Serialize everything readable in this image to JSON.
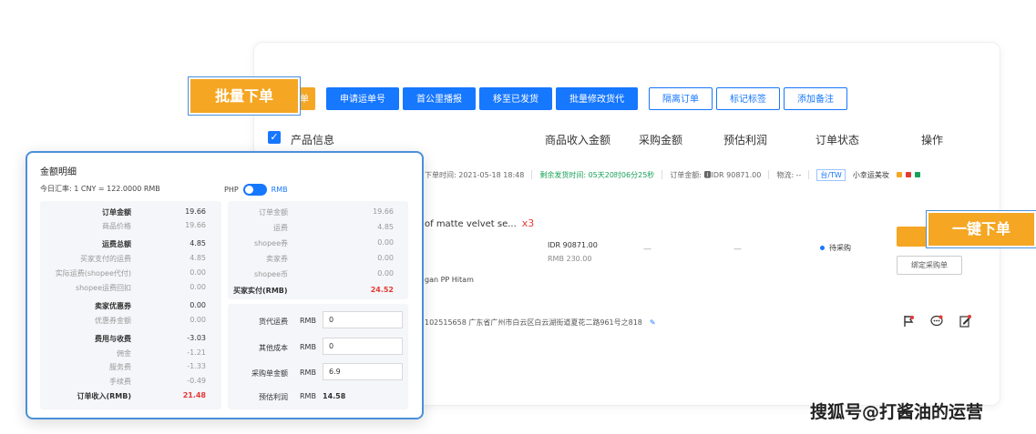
{
  "toolbar": {
    "first_tail": "单",
    "buttons": [
      "申请运单号",
      "首公里播报",
      "移至已发货",
      "批量修改货代"
    ],
    "outline_buttons": [
      "隔离订单",
      "标记标签",
      "添加备注"
    ]
  },
  "table_header": {
    "product": "产品信息",
    "income": "商品收入金额",
    "purchase": "采购金额",
    "profit": "预估利润",
    "status": "订单状态",
    "action": "操作"
  },
  "order": {
    "order_time": "下单时间: 2021-05-18 18:48",
    "remaining": "剩余发货时间: 05天20时06分25秒",
    "amount": "订单金额: 🅸IDR 90871.00",
    "logistics": "物流: --",
    "shop_tag": "台/TW",
    "shop_name": "小幸运美妆",
    "product_name": "of matte velvet se...",
    "quantity": "x3",
    "variant": "gan PP Hitam",
    "price_idr": "IDR 90871.00",
    "price_rmb": "RMB 230.00",
    "purchase_dash": "—",
    "profit_dash": "—",
    "status": "待采购",
    "bind_button": "绑定采购单",
    "address": "102515658  广东省广州市白云区白云湖街道夏花二路961号之818",
    "edit_icon": "✎"
  },
  "callouts": {
    "batch": "批量下单",
    "one_click": "一键下单"
  },
  "popup": {
    "title": "金额明细",
    "rate": "今日汇率: 1 CNY = 122.0000 RMB",
    "toggle_left": "PHP",
    "toggle_right": "RMB",
    "left_rows": [
      {
        "label": "订单金额",
        "value": "19.66",
        "bold": true
      },
      {
        "label": "商品价格",
        "value": "19.66",
        "bold": false
      },
      {
        "label": "运费总额",
        "value": "4.85",
        "bold": true
      },
      {
        "label": "买家支付的运费",
        "value": "4.85",
        "bold": false
      },
      {
        "label": "实际运费(shopee代付)",
        "value": "0.00",
        "bold": false
      },
      {
        "label": "shopee运费回扣",
        "value": "0.00",
        "bold": false
      },
      {
        "label": "卖家优惠券",
        "value": "0.00",
        "bold": true
      },
      {
        "label": "优惠券金额",
        "value": "0.00",
        "bold": false
      },
      {
        "label": "费用与收费",
        "value": "-3.03",
        "bold": true
      },
      {
        "label": "佣金",
        "value": "-1.21",
        "bold": false
      },
      {
        "label": "服务费",
        "value": "-1.33",
        "bold": false
      },
      {
        "label": "手续费",
        "value": "-0.49",
        "bold": false
      },
      {
        "label": "订单收入(RMB)",
        "value": "21.48",
        "bold": true,
        "red": true
      }
    ],
    "right_rows": [
      {
        "label": "订单金额",
        "value": "19.66"
      },
      {
        "label": "运费",
        "value": "4.85"
      },
      {
        "label": "shopee券",
        "value": "0.00"
      },
      {
        "label": "卖家券",
        "value": "0.00"
      },
      {
        "label": "shopee币",
        "value": "0.00"
      },
      {
        "label": "买家实付(RMB)",
        "value": "24.52",
        "red": true
      }
    ],
    "inputs": [
      {
        "label": "货代运费",
        "currency": "RMB",
        "value": "0"
      },
      {
        "label": "其他成本",
        "currency": "RMB",
        "value": "0"
      },
      {
        "label": "采购单金额",
        "currency": "RMB",
        "value": "6.9"
      }
    ],
    "profit_label": "预估利润",
    "profit_currency": "RMB",
    "profit_value": "14.58"
  },
  "watermark": "搜狐号@打酱油的运营"
}
